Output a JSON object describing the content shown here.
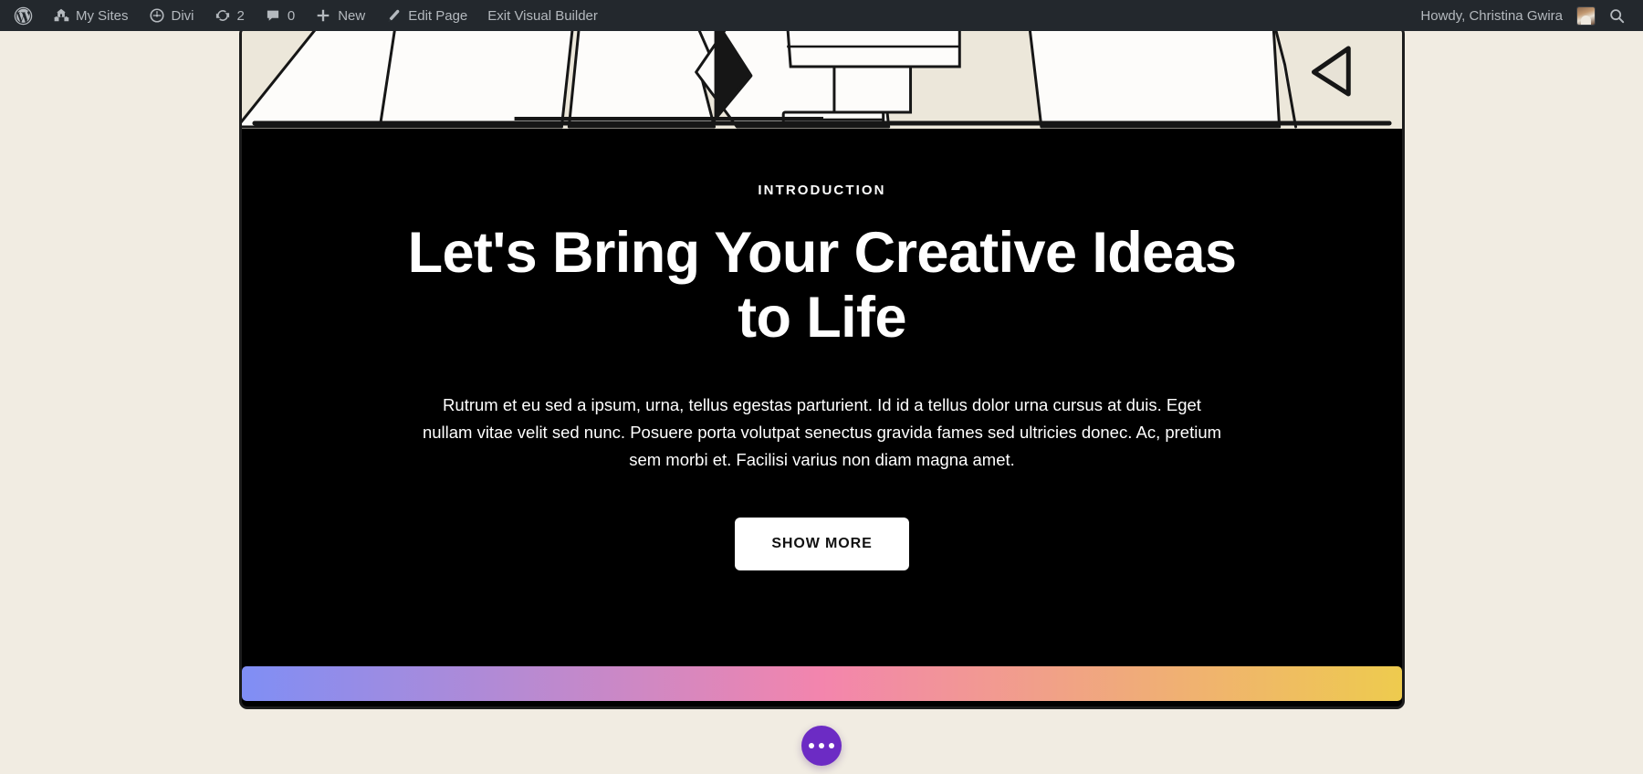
{
  "admin_bar": {
    "wp_logo": "wordpress-logo-icon",
    "items": [
      {
        "id": "my-sites",
        "icon": "sites-buildings-icon",
        "label": "My Sites"
      },
      {
        "id": "divi",
        "icon": "divi-dashboard-icon",
        "label": "Divi"
      },
      {
        "id": "updates",
        "icon": "update-arrows-icon",
        "label": "2"
      },
      {
        "id": "comments",
        "icon": "comment-bubble-icon",
        "label": "0"
      },
      {
        "id": "new",
        "icon": "plus-icon",
        "label": "New"
      },
      {
        "id": "edit-page",
        "icon": "pencil-icon",
        "label": "Edit Page"
      },
      {
        "id": "exit-vb",
        "icon": "",
        "label": "Exit Visual Builder"
      }
    ],
    "howdy": "Howdy, Christina Gwira",
    "avatar_alt": "user-avatar",
    "search_icon": "search-icon"
  },
  "section": {
    "eyebrow": "INTRODUCTION",
    "headline": "Let's Bring Your Creative Ideas to Life",
    "paragraph": "Rutrum et eu sed a ipsum, urna, tellus egestas parturient. Id id a tellus dolor urna cursus at duis. Eget nullam vitae velit sed nunc. Posuere porta volutpat senectus gravida fames sed ultricies donec. Ac, pretium sem morbi et. Facilisi varius non diam magna amet.",
    "cta_label": "SHOW MORE"
  },
  "floating_button": {
    "name": "more-options-icon",
    "label": "•••"
  },
  "colors": {
    "page_background": "#f1ece2",
    "admin_bar_background": "#23282d",
    "admin_bar_text": "#b4b9be",
    "section_background": "#000000",
    "section_border": "#1d1d1d",
    "illustration_background": "#ece7da",
    "illustration_ink": "#161616",
    "text_on_dark": "#ffffff",
    "cta_background": "#ffffff",
    "cta_text": "#111111",
    "fab_background": "#6c2bc4",
    "gradient_start": "#7f8ef5",
    "gradient_mid": "#f385ad",
    "gradient_end": "#eecb4e"
  }
}
